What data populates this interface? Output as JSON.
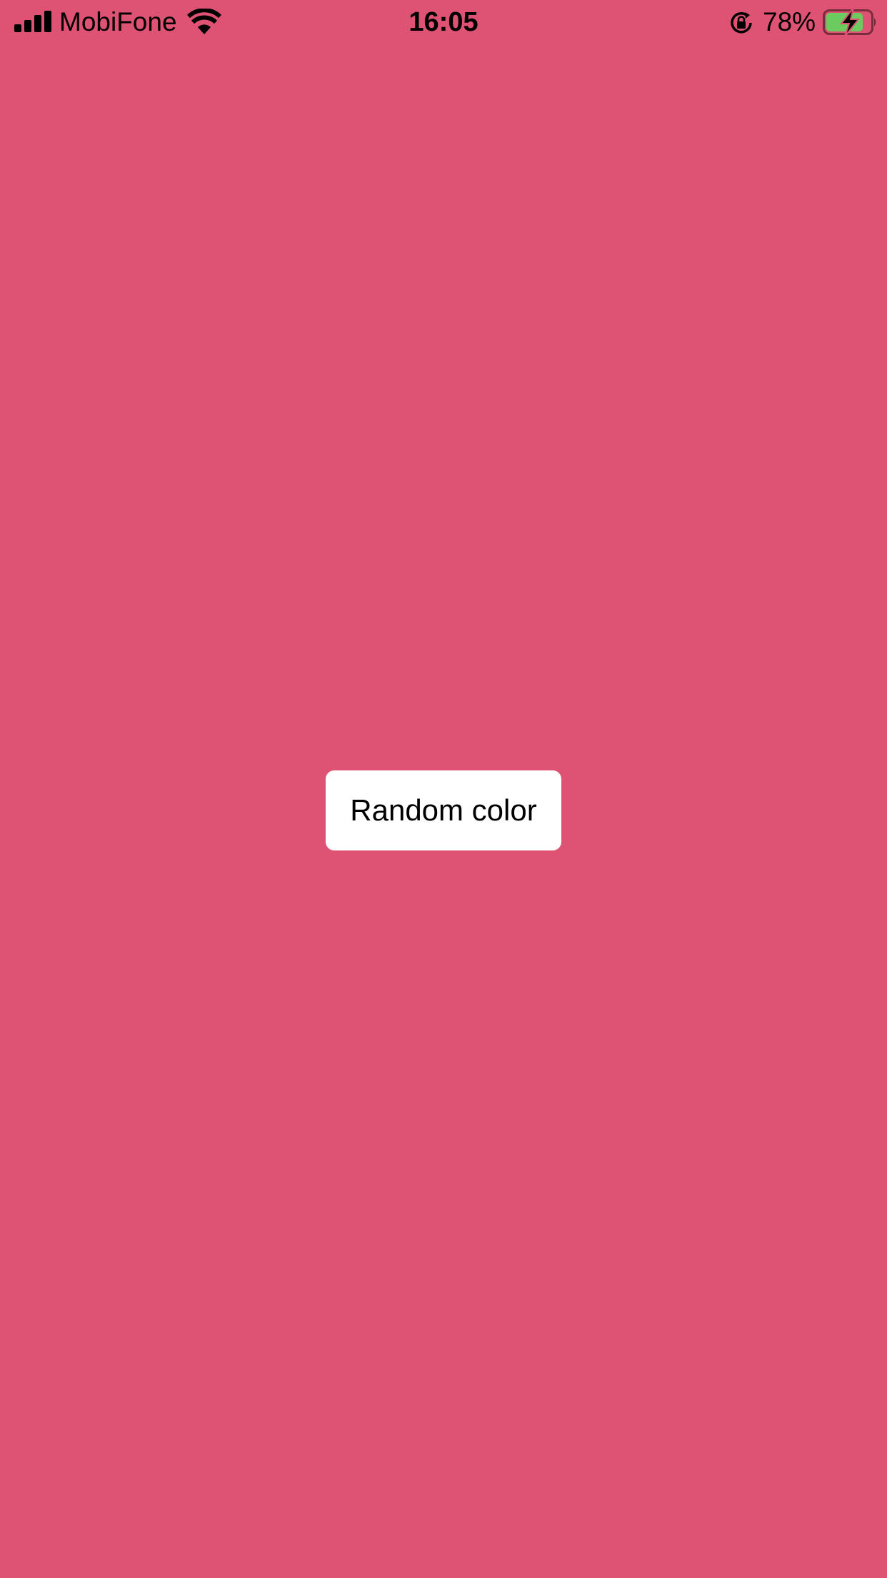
{
  "status_bar": {
    "carrier": "MobiFone",
    "time": "16:05",
    "battery_percent": "78%",
    "battery_level": 0.78,
    "icons": [
      "signal-icon",
      "wifi-icon",
      "rotation-lock-icon",
      "battery-charging-icon"
    ]
  },
  "main": {
    "button_label": "Random color",
    "background_color": "#DE5273",
    "button_color": "#FFFFFF"
  }
}
